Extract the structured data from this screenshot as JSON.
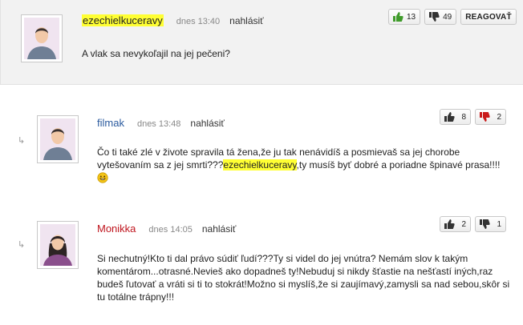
{
  "comments": [
    {
      "author": "ezechielkuceravy",
      "date": "dnes 13:40",
      "report": "nahlásiť",
      "text": "A vlak sa nevykoľajil na jej pečeni?",
      "likes": "13",
      "dislikes": "49",
      "reply": "REAGOVAŤ"
    },
    {
      "author": "filmak",
      "date": "dnes 13:48",
      "report": "nahlásiť",
      "text_before": "Čo ti také zlé v živote spravila tá žena,že ju tak nenávidíš a posmievaš sa jej chorobe vytešovaním sa z jej smrti???",
      "mention": "ezechielkuceravy",
      "text_after": ",ty musíš byť dobré a poriadne špinavé prasa!!!!",
      "likes": "8",
      "dislikes": "2"
    },
    {
      "author": "Monikka",
      "date": "dnes 14:05",
      "report": "nahlásiť",
      "text": "Si nechutný!Kto ti dal právo súdiť ľudí???Ty si videl do jej vnútra? Nemám slov k takým komentárom...otrasné.Nevieš ako dopadneš ty!Nebuduj si nikdy šťastie na nešťastí iných,raz budeš ľutovať a vráti si ti to stokrát!Možno si myslíš,že si zaujímavý,zamysli sa nad sebou,skôr si tu totálne trápny!!!",
      "likes": "2",
      "dislikes": "1"
    }
  ],
  "icons": {
    "reply_indent": "reply-arrow-icon",
    "like": "thumbs-up-icon",
    "dislike": "thumbs-down-icon",
    "emoji": "smiley-icon"
  },
  "colors": {
    "highlight": "#ffff33",
    "author_blue": "#2a5a9e",
    "author_red": "#c0161f",
    "like_green": "#3f9b2a",
    "dislike_red": "#c91a1a"
  }
}
